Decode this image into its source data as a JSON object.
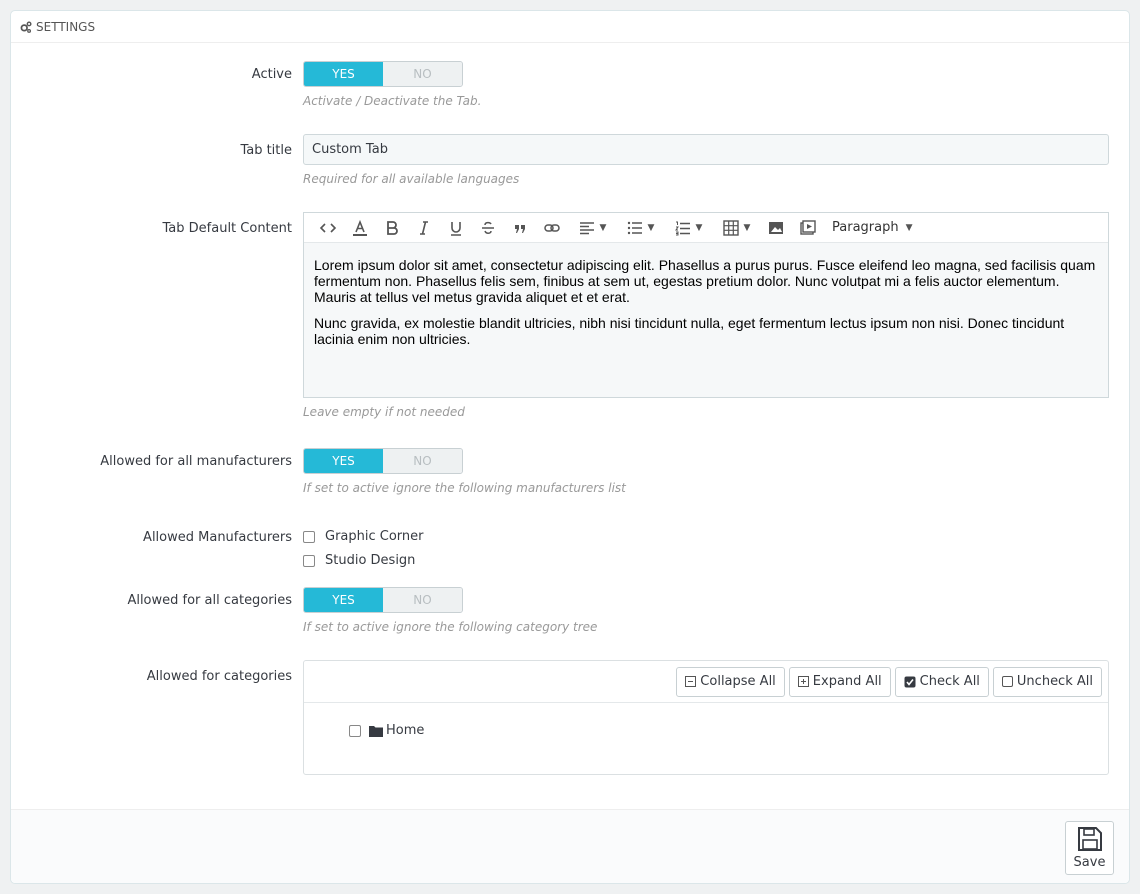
{
  "panel": {
    "heading": "SETTINGS"
  },
  "active": {
    "label": "Active",
    "yes": "YES",
    "no": "NO",
    "selected": "YES",
    "help": "Activate / Deactivate the Tab."
  },
  "tab_title": {
    "label": "Tab title",
    "value": "Custom Tab",
    "help": "Required for all available languages"
  },
  "content": {
    "label": "Tab Default Content",
    "format": "Paragraph",
    "paragraphs": [
      "Lorem ipsum dolor sit amet, consectetur adipiscing elit. Phasellus a purus purus. Fusce eleifend leo magna, sed facilisis quam fermentum non. Phasellus felis sem, finibus at sem ut, egestas pretium dolor. Nunc volutpat mi a felis auctor elementum. Mauris at tellus vel metus gravida aliquet et et erat.",
      "Nunc gravida, ex molestie blandit ultricies, nibh nisi tincidunt nulla, eget fermentum lectus ipsum non nisi. Donec tincidunt lacinia enim non ultricies."
    ],
    "help": "Leave empty if not needed"
  },
  "all_manufacturers": {
    "label": "Allowed for all manufacturers",
    "yes": "YES",
    "no": "NO",
    "selected": "YES",
    "help": "If set to active ignore the following manufacturers list"
  },
  "manufacturers": {
    "label": "Allowed Manufacturers",
    "items": [
      "Graphic Corner",
      "Studio Design"
    ]
  },
  "all_categories": {
    "label": "Allowed for all categories",
    "yes": "YES",
    "no": "NO",
    "selected": "YES",
    "help": "If set to active ignore the following category tree"
  },
  "categories": {
    "label": "Allowed for categories",
    "collapse": "Collapse All",
    "expand": "Expand All",
    "check": "Check All",
    "uncheck": "Uncheck All",
    "root": "Home"
  },
  "footer": {
    "save": "Save"
  },
  "colors": {
    "accent": "#25b9d7"
  }
}
